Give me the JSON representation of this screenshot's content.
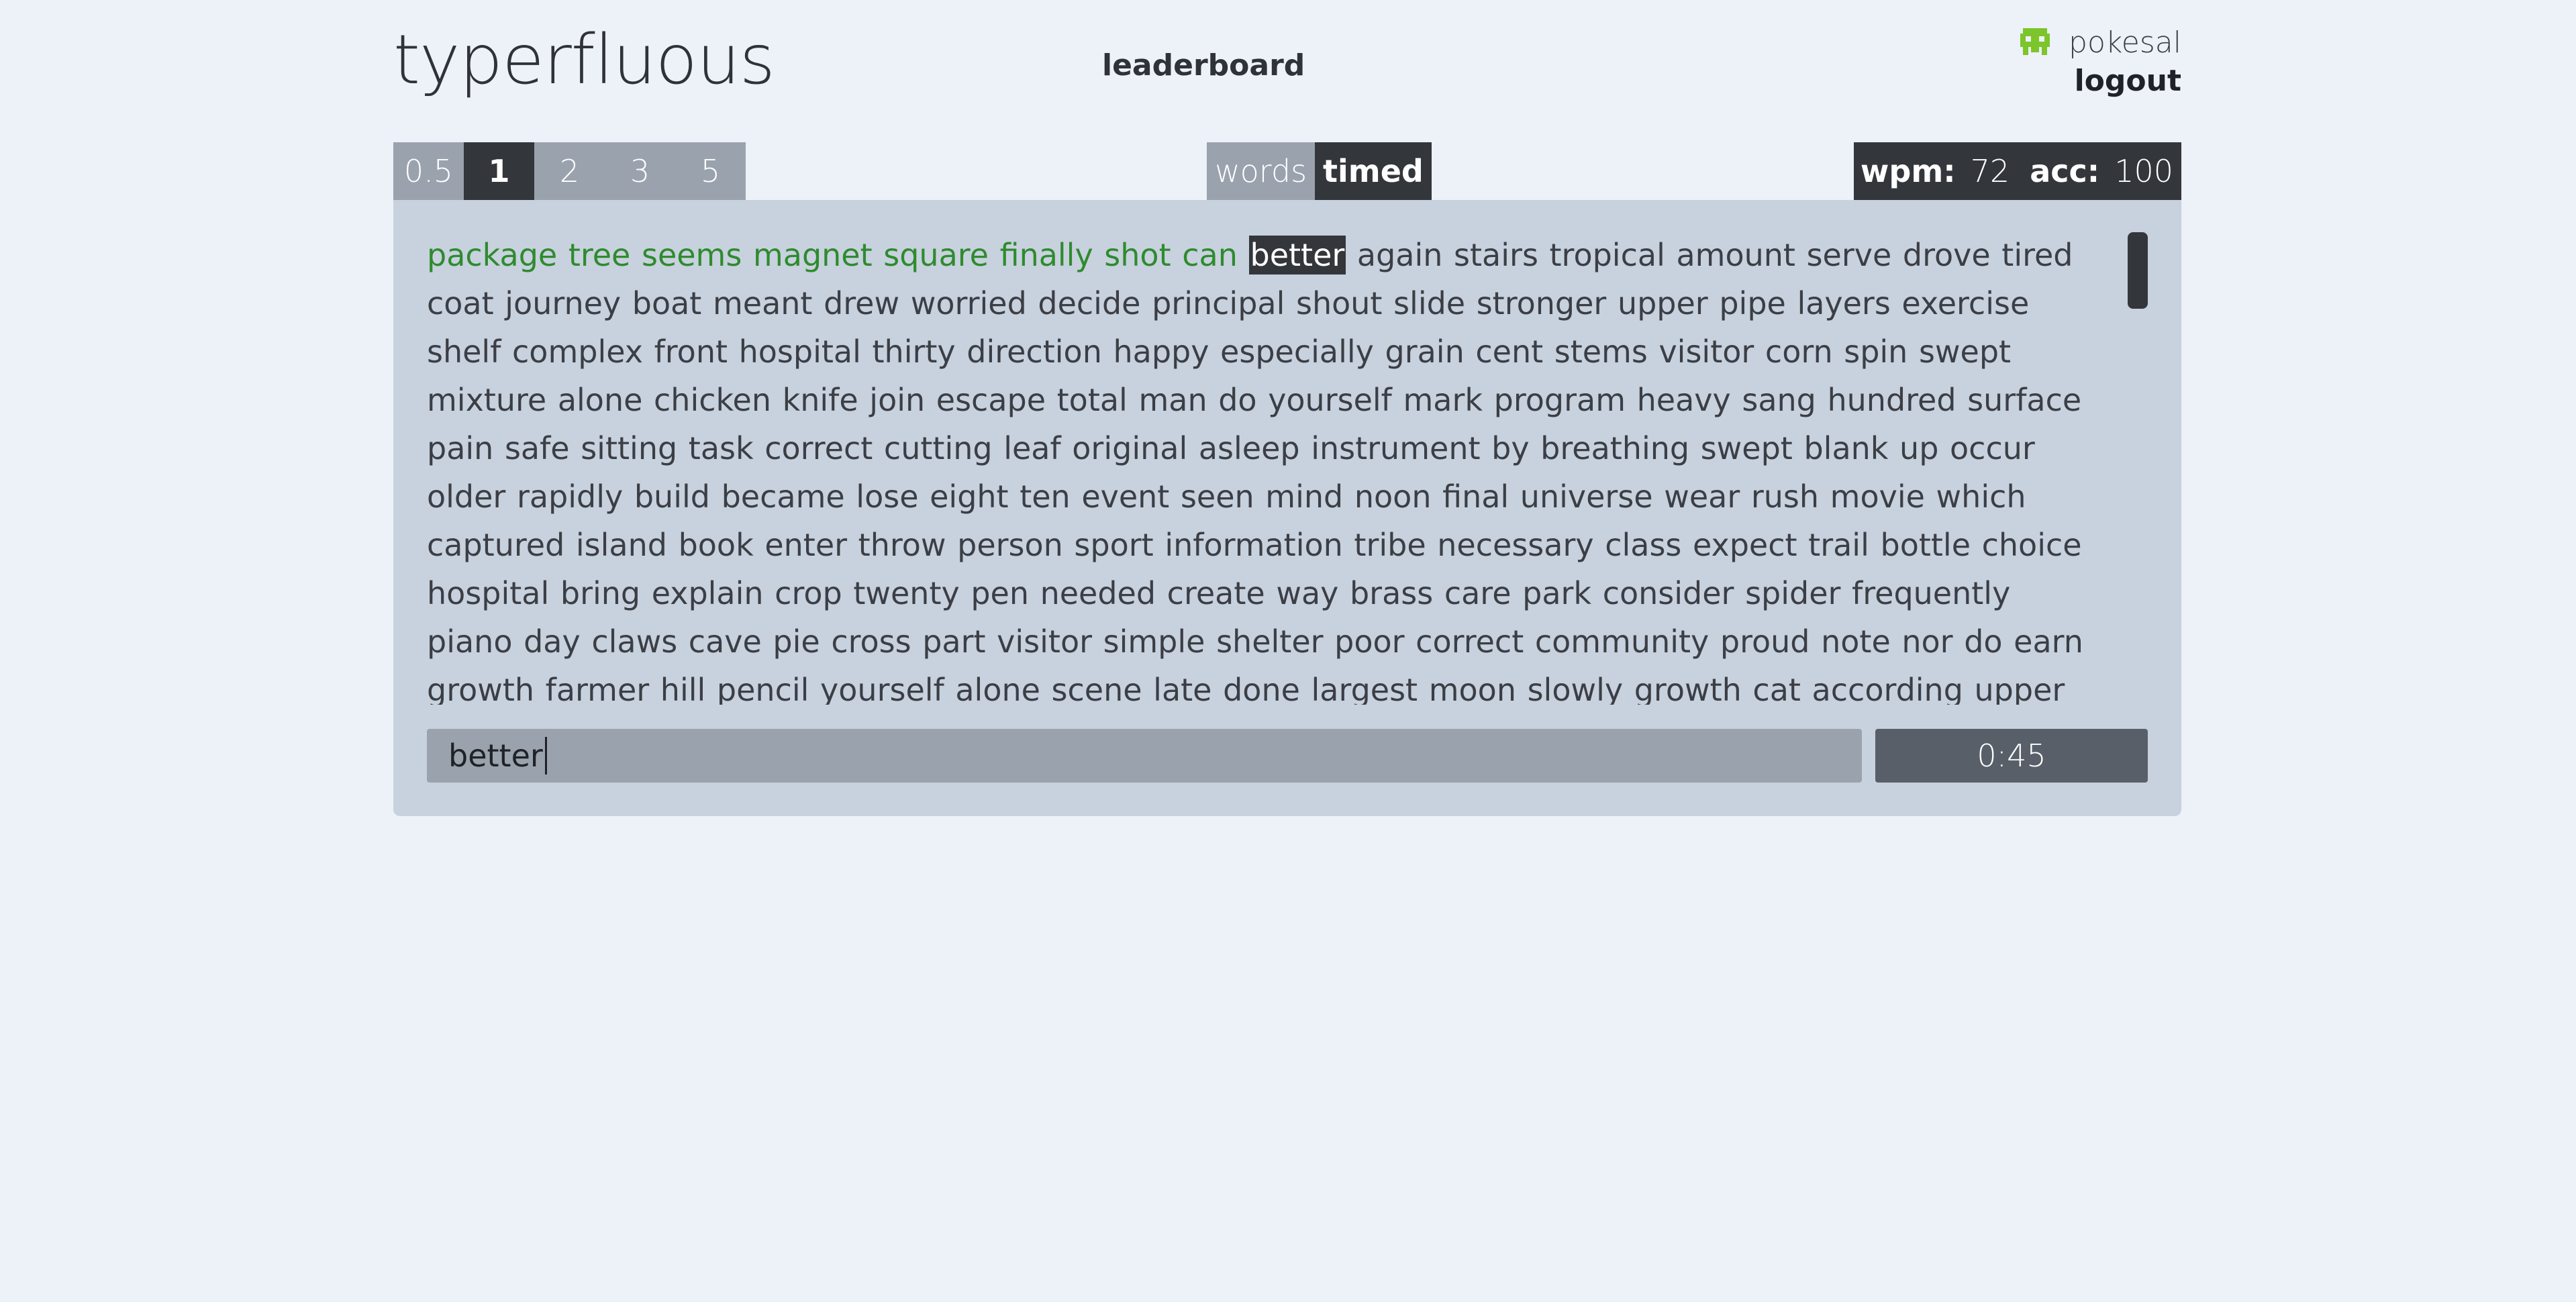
{
  "header": {
    "logo": "typerfluous",
    "nav_leaderboard": "leaderboard",
    "username": "pokesal",
    "logout": "logout",
    "avatar_icon": "pixel-invader-icon",
    "avatar_color": "#7cc52b"
  },
  "time_options": [
    "0.5",
    "1",
    "2",
    "3",
    "5"
  ],
  "time_selected": "1",
  "mode": {
    "words": "words",
    "timed": "timed",
    "selected": "timed"
  },
  "stats": {
    "wpm_label": "wpm:",
    "wpm_value": "72",
    "acc_label": "acc:",
    "acc_value": "100"
  },
  "text": {
    "typed": "package tree seems magnet square finally shot can",
    "current": "better",
    "remaining": "again stairs tropical amount serve drove tired coat journey boat meant drew worried decide principal shout slide stronger upper pipe layers exercise shelf complex front hospital thirty direction happy especially grain cent stems visitor corn spin swept mixture alone chicken knife join escape total man do yourself mark program heavy sang hundred surface pain safe sitting task correct cutting leaf original asleep instrument by breathing swept blank up occur older rapidly build became lose eight ten event seen mind noon final universe wear rush movie which captured island book enter throw person sport information tribe necessary class expect trail bottle choice hospital bring explain crop twenty pen needed create way brass care park consider spider frequently piano day claws cave pie cross part visitor simple shelter poor correct community proud note nor do earn growth farmer hill pencil yourself alone scene late done largest moon slowly growth cat according upper top bag contrast least eaten teach baseball unit tight smaller apple silent grown drop"
  },
  "input": {
    "value": "better"
  },
  "timer": "0:45",
  "colors": {
    "background": "#edf1f8",
    "panel": "#c8d1de",
    "correct_text": "#2e8b2e",
    "active_segment": "#33363b",
    "inactive_segment": "#9aa2ad"
  }
}
